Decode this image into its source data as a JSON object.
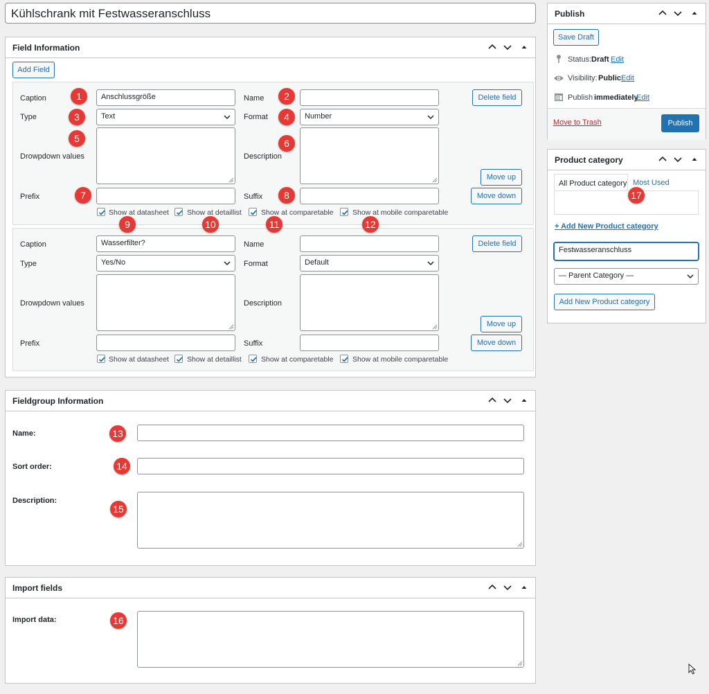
{
  "post_title": "Kühlschrank mit Festwasseranschluss",
  "colors": {
    "accent": "#2271b1",
    "badge": "#e53935",
    "trash": "#b32d2e"
  },
  "field_info": {
    "title": "Field Information",
    "add_field": "Add Field",
    "fields": [
      {
        "caption_label": "Caption",
        "caption_value": "Anschlussgröße",
        "name_label": "Name",
        "name_value": "",
        "delete": "Delete field",
        "type_label": "Type",
        "type_value": "Text",
        "format_label": "Format",
        "format_value": "Number",
        "dropdown_label": "Drowpdown values",
        "description_label": "Description",
        "move_up": "Move up",
        "move_down": "Move down",
        "prefix_label": "Prefix",
        "suffix_label": "Suffix",
        "checks": [
          {
            "label": "Show at datasheet",
            "checked": true
          },
          {
            "label": "Show at detaillist",
            "checked": true
          },
          {
            "label": "Show at comparetable",
            "checked": true
          },
          {
            "label": "Show at mobile comparetable",
            "checked": true
          }
        ]
      },
      {
        "caption_label": "Caption",
        "caption_value": "Wasserfilter?",
        "name_label": "Name",
        "name_value": "",
        "delete": "Delete field",
        "type_label": "Type",
        "type_value": "Yes/No",
        "format_label": "Format",
        "format_value": "Default",
        "dropdown_label": "Drowpdown values",
        "description_label": "Description",
        "move_up": "Move up",
        "move_down": "Move down",
        "prefix_label": "Prefix",
        "suffix_label": "Suffix",
        "checks": [
          {
            "label": "Show at datasheet",
            "checked": true
          },
          {
            "label": "Show at detaillist",
            "checked": true
          },
          {
            "label": "Show at comparetable",
            "checked": true
          },
          {
            "label": "Show at mobile comparetable",
            "checked": true
          }
        ]
      }
    ]
  },
  "fieldgroup": {
    "title": "Fieldgroup Information",
    "name_label": "Name:",
    "sort_label": "Sort order:",
    "description_label": "Description:"
  },
  "import": {
    "title": "Import fields",
    "data_label": "Import data:"
  },
  "publish": {
    "title": "Publish",
    "save_draft": "Save Draft",
    "status_label": "Status:",
    "status_value": "Draft",
    "visibility_label": "Visibility:",
    "visibility_value": "Public",
    "publish_label": "Publish",
    "publish_value": "immediately",
    "edit": "Edit",
    "trash": "Move to Trash",
    "publish_button": "Publish"
  },
  "category": {
    "title": "Product category",
    "tab_all": "All Product category",
    "tab_most": "Most Used",
    "add_new_link": "+ Add New Product category",
    "new_value": "Festwasseranschluss",
    "parent_select": "— Parent Category —",
    "add_button": "Add New Product category"
  },
  "badges": [
    "1",
    "2",
    "3",
    "4",
    "5",
    "6",
    "7",
    "8",
    "9",
    "10",
    "11",
    "12",
    "13",
    "14",
    "15",
    "16",
    "17"
  ]
}
